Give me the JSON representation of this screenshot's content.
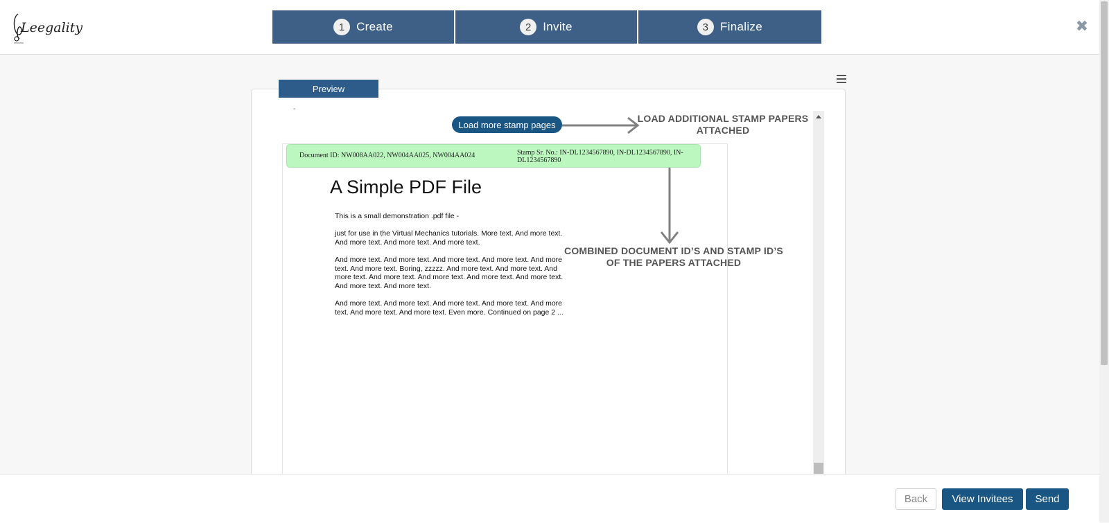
{
  "header": {
    "logo_text": "Leegality",
    "steps": [
      {
        "number": "1",
        "label": "Create"
      },
      {
        "number": "2",
        "label": "Invite"
      },
      {
        "number": "3",
        "label": "Finalize"
      }
    ],
    "close_glyph": "✖"
  },
  "preview": {
    "tab_label": "Preview",
    "dash": "-",
    "load_more_label": "Load more stamp pages",
    "annotation_load": "LOAD ADDITIONAL STAMP PAPERS ATTACHED",
    "annotation_combined": "COMBINED DOCUMENT ID’S AND STAMP ID’S OF THE PAPERS ATTACHED",
    "document_id": "Document ID: NW008AA022, NW004AA025, NW004AA024",
    "stamp_sr_no": "Stamp Sr. No.: IN-DL1234567890, IN-DL1234567890, IN-DL1234567890"
  },
  "pdf": {
    "title": "A Simple PDF File",
    "paragraphs": [
      "This is a small demonstration .pdf file -",
      "just for use in the Virtual Mechanics tutorials. More text. And more text. And more text. And more text. And more text.",
      "And more text. And more text. And more text. And more text. And more text. And more text. Boring, zzzzz. And more text. And more text. And more text. And more text. And more text. And more text. And more text. And more text. And more text.",
      "And more text. And more text. And more text. And more text. And more text. And more text. And more text. Even more. Continued on page 2 ..."
    ]
  },
  "footer": {
    "back_label": "Back",
    "view_invitees_label": "View Invitees",
    "send_label": "Send"
  },
  "colors": {
    "step_bg": "#3e6086",
    "primary": "#1a5684",
    "green_bar": "#bcf7c0"
  }
}
